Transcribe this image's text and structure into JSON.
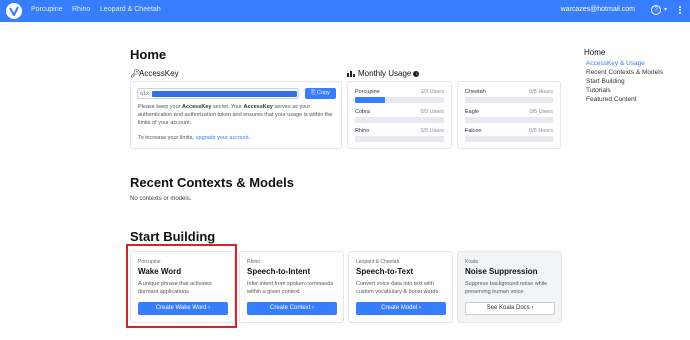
{
  "nav": {
    "links": [
      "Porcupine",
      "Rhino",
      "Leopard & Cheetah"
    ],
    "user_email": "warcazes@hotmail.com",
    "help_icon": "?",
    "caret": "▾"
  },
  "home": {
    "title": "Home",
    "accesskey": {
      "title": "AccessKey",
      "key_prefix": "q1x",
      "copy_label": "Copy",
      "text1_a": "Please keep your ",
      "text1_b": "AccessKey",
      "text1_c": " secret. Your ",
      "text1_d": "AccessKey",
      "text1_e": " serves as your authentication and authorization token and ensures that your usage is within the limits of your account.",
      "text2_prefix": "To increase your limits, ",
      "text2_link": "upgrade your account",
      "text2_suffix": "."
    },
    "usage": {
      "title": "Monthly Usage",
      "left": [
        {
          "name": "Porcupine",
          "qty": "1/3 Users",
          "fill": 0.333
        },
        {
          "name": "Cobra",
          "qty": "0/3 Users",
          "fill": 0
        },
        {
          "name": "Rhino",
          "qty": "0/3 Users",
          "fill": 0
        }
      ],
      "right": [
        {
          "name": "Cheetah",
          "qty": "0/5 Hours",
          "fill": 0
        },
        {
          "name": "Eagle",
          "qty": "0/5 Users",
          "fill": 0
        },
        {
          "name": "Falcon",
          "qty": "0/5 Hours",
          "fill": 0
        }
      ]
    }
  },
  "recent": {
    "title": "Recent Contexts & Models",
    "empty": "No contexts or models."
  },
  "start": {
    "title": "Start Building",
    "cards": [
      {
        "kicker": "Porcupine",
        "title": "Wake Word",
        "desc": "A unique phrase that activates dormant applications",
        "button": "Create Wake Word  ›"
      },
      {
        "kicker": "Rhino",
        "title": "Speech-to-Intent",
        "desc": "Infer intent from spoken commands within a given context",
        "button": "Create Context  ›"
      },
      {
        "kicker": "Leopard & Cheetah",
        "title": "Speech-to-Text",
        "desc": "Convert voice data into text with custom vocabulary & boost words",
        "button": "Create Model  ›"
      },
      {
        "kicker": "Koala",
        "title": "Noise Suppression",
        "desc": "Suppress background noise while preserving human voice",
        "button": "See Koala Docs  ›"
      }
    ]
  },
  "sidebar": {
    "title": "Home",
    "items": [
      "AccessKey & Usage",
      "Recent Contexts & Models",
      "Start Building",
      "Tutorials",
      "Featured Content"
    ]
  },
  "colors": {
    "brand": "#377dff",
    "highlight": "#d8232a"
  }
}
